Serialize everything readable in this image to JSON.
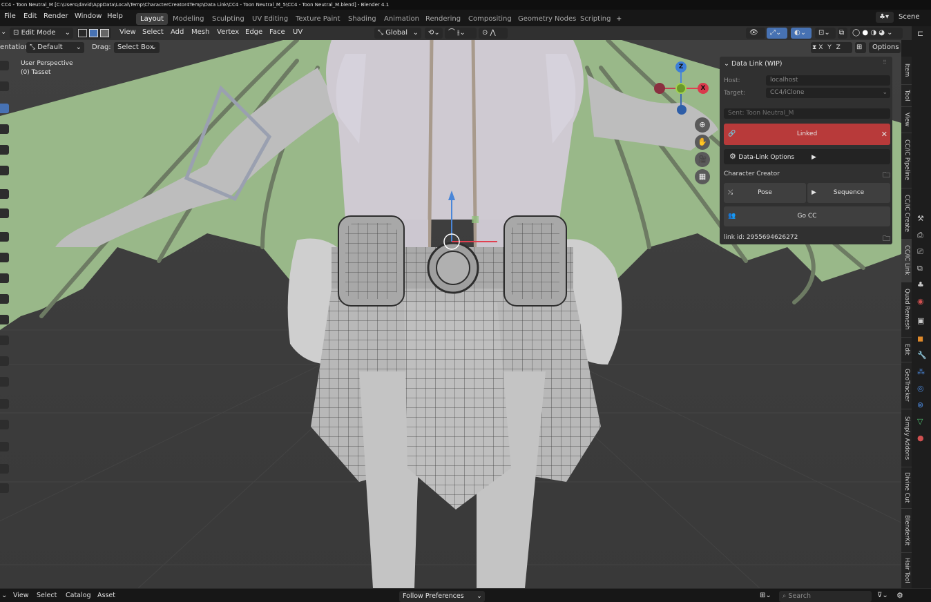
{
  "window": {
    "title": "CC4 - Toon Neutral_M [C:\\Users\\david\\AppData\\Local\\Temp\\CharacterCreator4Temp\\Data Link\\CC4 - Toon Neutral_M_5\\CC4 - Toon Neutral_M.blend] - Blender 4.1"
  },
  "menu": {
    "file": "File",
    "edit": "Edit",
    "render": "Render",
    "window": "Window",
    "help": "Help"
  },
  "workspaces": [
    "Layout",
    "Modeling",
    "Sculpting",
    "UV Editing",
    "Texture Paint",
    "Shading",
    "Animation",
    "Rendering",
    "Compositing",
    "Geometry Nodes",
    "Scripting"
  ],
  "active_workspace": "Layout",
  "add_workspace": "+",
  "scene": {
    "label": "Scene"
  },
  "viewport_header": {
    "mode": "Edit Mode",
    "view": "View",
    "select": "Select",
    "add": "Add",
    "mesh": "Mesh",
    "vertex": "Vertex",
    "edge": "Edge",
    "face": "Face",
    "uv": "UV",
    "transform_orientation": "Global",
    "orientation_label": "entation:",
    "orientation_value": "Default",
    "drag_label": "Drag:",
    "drag_value": "Select Box",
    "axis_x": "X",
    "axis_y": "Y",
    "axis_z": "Z",
    "options": "Options"
  },
  "overlay": {
    "perspective": "User Perspective",
    "object": "(0) Tasset"
  },
  "gizmo": {
    "z": "Z",
    "x": "X"
  },
  "data_link_panel": {
    "header": "Data Link (WIP)",
    "host_label": "Host:",
    "host_value": "localhost",
    "target_label": "Target:",
    "target_value": "CC4/iClone",
    "sent": "Sent: Toon Neutral_M",
    "linked": "Linked",
    "linked_color": "#b83a3a",
    "options_label": "Data-Link Options",
    "section_cc": "Character Creator",
    "pose": "Pose",
    "sequence": "Sequence",
    "go_cc": "Go CC",
    "link_id": "link id: 2955694626272"
  },
  "side_tabs": [
    "Item",
    "Tool",
    "View",
    "CC/IC Pipeline",
    "CC/IC Create",
    "CC/IC Link",
    "Quad Remesh",
    "Edit",
    "GeoTracker",
    "Simply Addons",
    "Divine Cut",
    "BlenderKit",
    "Hair Tool"
  ],
  "bottom": {
    "view": "View",
    "select": "Select",
    "catalog": "Catalog",
    "asset": "Asset",
    "follow": "Follow Preferences",
    "search_placeholder": "Search"
  },
  "colors": {
    "wing": "#99b889",
    "skin": "#c9c9c9",
    "accent": "#4772b3"
  }
}
